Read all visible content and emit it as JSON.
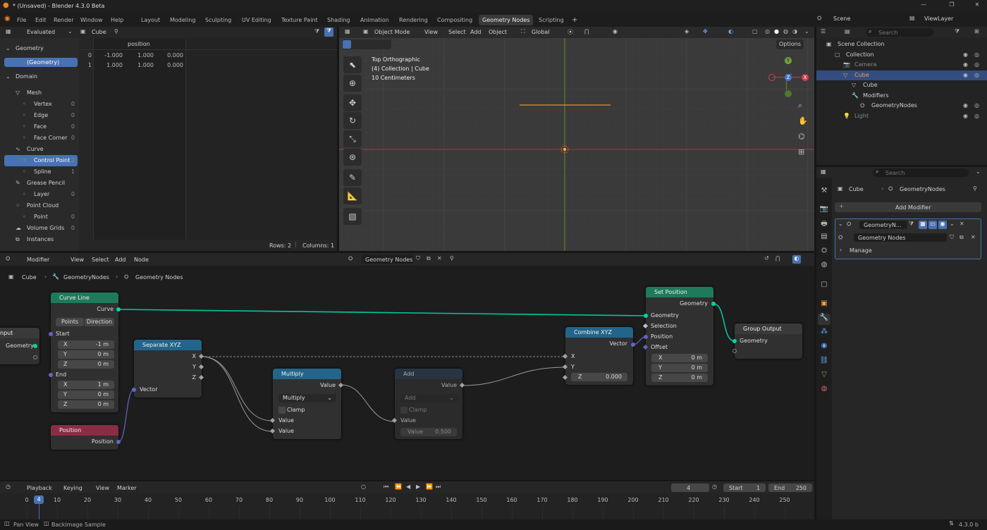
{
  "window": {
    "title": "* (Unsaved) - Blender 4.3.0 Beta",
    "controls": [
      "—",
      "❐",
      "✕"
    ]
  },
  "menu": [
    "File",
    "Edit",
    "Render",
    "Window",
    "Help"
  ],
  "workspaces": [
    "Layout",
    "Modeling",
    "Sculpting",
    "UV Editing",
    "Texture Paint",
    "Shading",
    "Animation",
    "Rendering",
    "Compositing",
    "Geometry Nodes",
    "Scripting",
    "+"
  ],
  "active_workspace": "Geometry Nodes",
  "spreadsheet": {
    "header": {
      "mode": "Evaluated",
      "object": "Cube"
    },
    "geometry_label": "Geometry",
    "geometry_item": "(Geometry)",
    "domain_label": "Domain",
    "tree": [
      {
        "label": "Mesh",
        "count": "",
        "indent": 0
      },
      {
        "label": "Vertex",
        "count": "0",
        "indent": 1
      },
      {
        "label": "Edge",
        "count": "0",
        "indent": 1
      },
      {
        "label": "Face",
        "count": "0",
        "indent": 1
      },
      {
        "label": "Face Corner",
        "count": "0",
        "indent": 1
      },
      {
        "label": "Curve",
        "count": "",
        "indent": 0
      },
      {
        "label": "Control Point",
        "count": "2",
        "indent": 1,
        "selected": true
      },
      {
        "label": "Spline",
        "count": "1",
        "indent": 1
      },
      {
        "label": "Grease Pencil",
        "count": "",
        "indent": 0
      },
      {
        "label": "Layer",
        "count": "0",
        "indent": 1
      },
      {
        "label": "Point Cloud",
        "count": "",
        "indent": 0
      },
      {
        "label": "Point",
        "count": "0",
        "indent": 1
      },
      {
        "label": "Volume Grids",
        "count": "0",
        "indent": 0
      },
      {
        "label": "Instances",
        "count": "",
        "indent": 0
      }
    ],
    "column": "position",
    "rows": [
      {
        "i": "0",
        "x": "-1.000",
        "y": "1.000",
        "z": "0.000"
      },
      {
        "i": "1",
        "x": "1.000",
        "y": "1.000",
        "z": "0.000"
      }
    ],
    "footer_rows": "Rows: 2",
    "footer_cols": "Columns: 1"
  },
  "viewport": {
    "menu": [
      "Object Mode",
      "View",
      "Select",
      "Add",
      "Object"
    ],
    "transform": "Global",
    "options": "Options",
    "info": [
      "Top Orthographic",
      "(4) Collection | Cube",
      "10 Centimeters"
    ],
    "gizmo": {
      "x": "X",
      "y": "Y",
      "z": "Z"
    }
  },
  "outliner": {
    "scene": "Scene",
    "viewlayer": "ViewLayer",
    "search": "Search",
    "items": [
      {
        "label": "Scene Collection",
        "indent": 0
      },
      {
        "label": "Collection",
        "indent": 1
      },
      {
        "label": "Camera",
        "indent": 2
      },
      {
        "label": "Cube",
        "indent": 2,
        "selected": true
      },
      {
        "label": "Cube",
        "indent": 3
      },
      {
        "label": "Modifiers",
        "indent": 3
      },
      {
        "label": "GeometryNodes",
        "indent": 4
      },
      {
        "label": "Light",
        "indent": 2
      }
    ]
  },
  "properties": {
    "search": "Search",
    "breadcrumb": [
      "Cube",
      "GeometryNodes"
    ],
    "add_modifier": "Add Modifier",
    "modifier_name": "GeometryN...",
    "node_group": "Geometry Nodes",
    "manage": "Manage"
  },
  "node_editor": {
    "menu": [
      "Modifier",
      "View",
      "Select",
      "Add",
      "Node"
    ],
    "tree_name": "Geometry Nodes",
    "breadcrumb": [
      "Cube",
      "GeometryNodes",
      "Geometry Nodes"
    ],
    "nodes": {
      "group_input": {
        "title": "nput",
        "out": "Geometry"
      },
      "curve_line": {
        "title": "Curve Line",
        "out": "Curve",
        "mode_a": "Points",
        "mode_b": "Direction",
        "start": "Start",
        "end": "End",
        "sx": "-1 m",
        "sy": "0 m",
        "sz": "0 m",
        "ex": "1 m",
        "ey": "0 m",
        "ez": "0 m"
      },
      "position": {
        "title": "Position",
        "out": "Position"
      },
      "separate": {
        "title": "Separate XYZ",
        "x": "X",
        "y": "Y",
        "z": "Z",
        "in": "Vector"
      },
      "multiply": {
        "title": "Multiply",
        "out": "Value",
        "op": "Multiply",
        "clamp": "Clamp",
        "in1": "Value",
        "in2": "Value"
      },
      "add": {
        "title": "Add",
        "out": "Value",
        "op": "Add",
        "clamp": "Clamp",
        "in1": "Value",
        "in2": "Value",
        "in2_val": "0.500"
      },
      "combine": {
        "title": "Combine XYZ",
        "out": "Vector",
        "x": "X",
        "y": "Y",
        "z": "Z",
        "z_val": "0.000"
      },
      "set_position": {
        "title": "Set Position",
        "out": "Geometry",
        "geo": "Geometry",
        "sel": "Selection",
        "pos": "Position",
        "off": "Offset",
        "ox": "0 m",
        "oy": "0 m",
        "oz": "0 m"
      },
      "group_output": {
        "title": "Group Output",
        "in": "Geometry"
      }
    },
    "axis_labels": {
      "x": "X",
      "y": "Y",
      "z": "Z"
    }
  },
  "timeline": {
    "menu": [
      "Playback",
      "Keying",
      "View",
      "Marker"
    ],
    "current": "4",
    "start_label": "Start",
    "start": "1",
    "end_label": "End",
    "end": "250",
    "ticks": [
      "0",
      "10",
      "20",
      "30",
      "40",
      "50",
      "60",
      "70",
      "80",
      "90",
      "100",
      "110",
      "120",
      "130",
      "140",
      "150",
      "160",
      "170",
      "180",
      "190",
      "200",
      "210",
      "220",
      "230",
      "240",
      "250"
    ]
  },
  "status": {
    "left1": "Pan View",
    "left2": "Backimage Sample",
    "version": "4.3.0 b"
  }
}
